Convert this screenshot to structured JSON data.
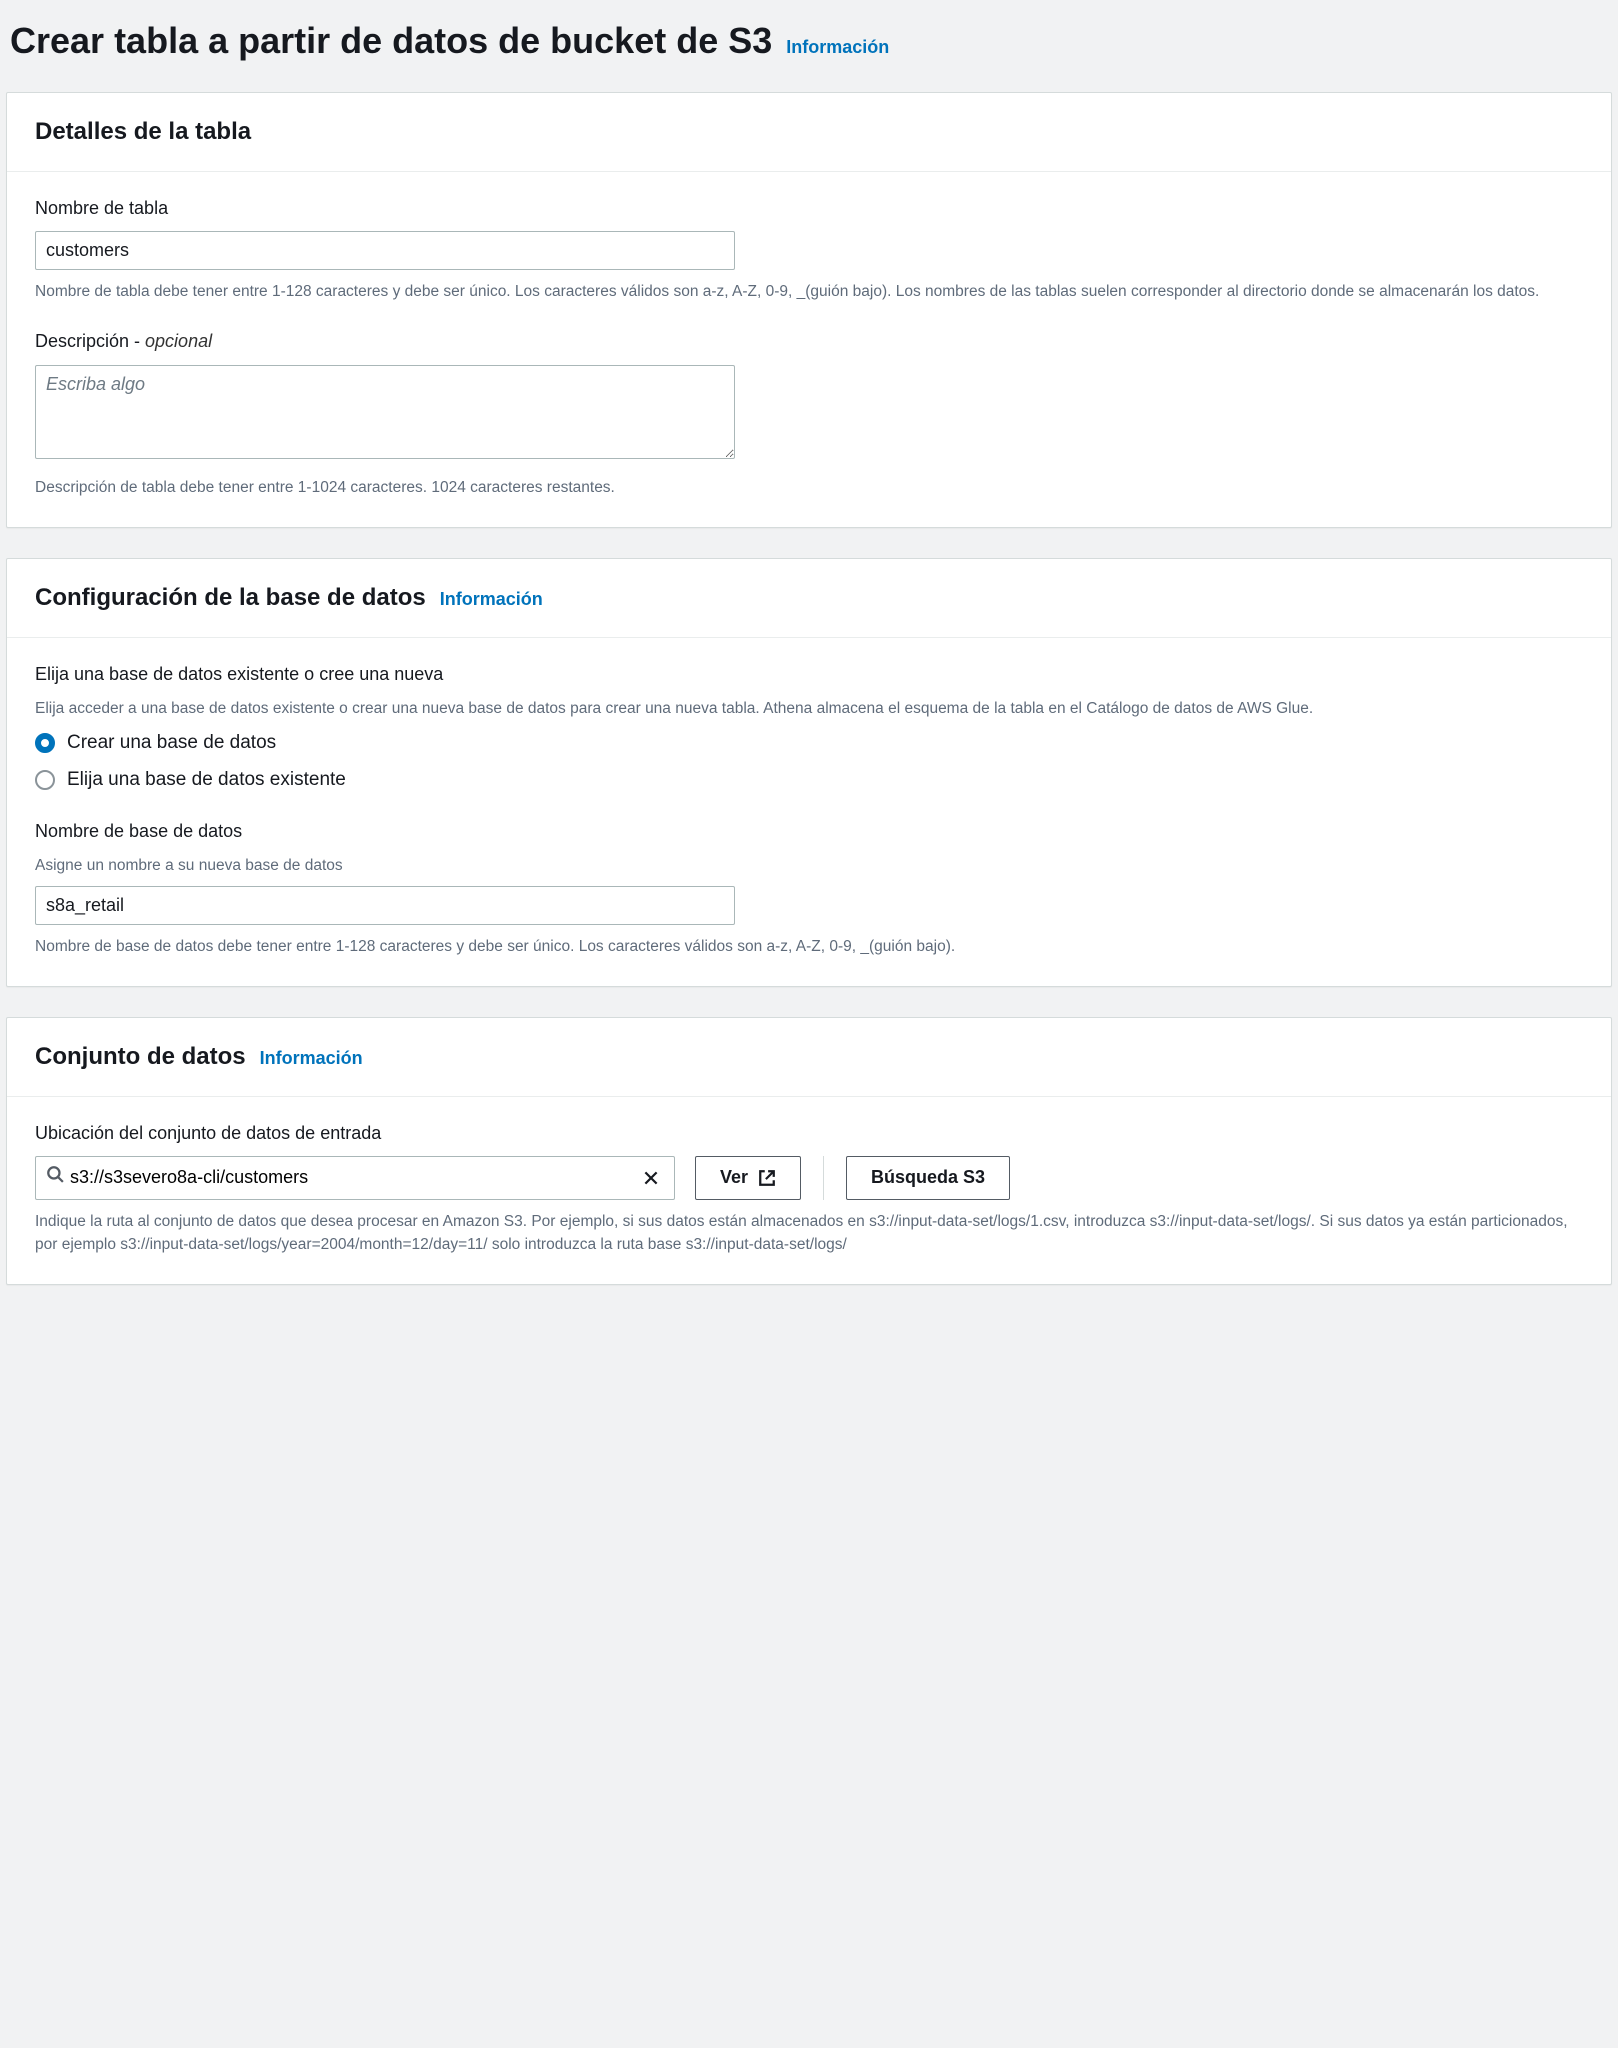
{
  "page": {
    "title": "Crear tabla a partir de datos de bucket de S3",
    "info_label": "Información"
  },
  "tableDetails": {
    "heading": "Detalles de la tabla",
    "name": {
      "label": "Nombre de tabla",
      "value": "customers",
      "help": "Nombre de tabla debe tener entre 1-128 caracteres y debe ser único. Los caracteres válidos son a-z, A-Z, 0-9, _(guión bajo). Los nombres de las tablas suelen corresponder al directorio donde se almacenarán los datos."
    },
    "description": {
      "label": "Descripción - ",
      "optional": "opcional",
      "placeholder": "Escriba algo",
      "value": "",
      "help": "Descripción de tabla debe tener entre 1-1024 caracteres. 1024 caracteres restantes."
    }
  },
  "dbConfig": {
    "heading": "Configuración de la base de datos",
    "info_label": "Información",
    "choose": {
      "label": "Elija una base de datos existente o cree una nueva",
      "help": "Elija acceder a una base de datos existente o crear una nueva base de datos para crear una nueva tabla. Athena almacena el esquema de la tabla en el Catálogo de datos de AWS Glue.",
      "option_create": "Crear una base de datos",
      "option_existing": "Elija una base de datos existente"
    },
    "dbname": {
      "label": "Nombre de base de datos",
      "sublabel": "Asigne un nombre a su nueva base de datos",
      "value": "s8a_retail",
      "help": "Nombre de base de datos debe tener entre 1-128 caracteres y debe ser único. Los caracteres válidos son a-z, A-Z, 0-9, _(guión bajo)."
    }
  },
  "dataset": {
    "heading": "Conjunto de datos",
    "info_label": "Información",
    "location": {
      "label": "Ubicación del conjunto de datos de entrada",
      "value": "s3://s3severo8a-cli/customers",
      "view_label": "Ver",
      "browse_label": "Búsqueda S3",
      "help": "Indique la ruta al conjunto de datos que desea procesar en Amazon S3. Por ejemplo, si sus datos están almacenados en s3://input-data-set/logs/1.csv, introduzca s3://input-data-set/logs/. Si sus datos ya están particionados, por ejemplo s3://input-data-set/logs/year=2004/month=12/day=11/ solo introduzca la ruta base s3://input-data-set/logs/"
    }
  }
}
